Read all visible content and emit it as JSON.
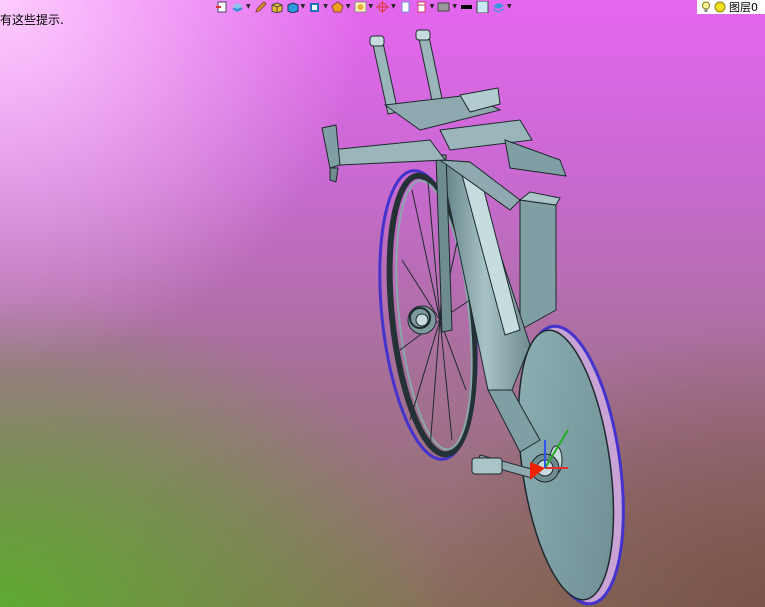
{
  "hint_text": "有这些提示.",
  "toolbar": {
    "tools": [
      {
        "name": "layer-states-icon",
        "color": "#d33"
      },
      {
        "name": "layer-manager-icon",
        "color": "#3a8fd6"
      },
      {
        "name": "pencil-icon",
        "color": "#e0a020"
      },
      {
        "name": "box-icon",
        "color": "#2e9be0"
      },
      {
        "name": "solid-icon",
        "color": "#2e7dd6"
      },
      {
        "name": "view-cube-icon",
        "color": "#1f6fc0"
      },
      {
        "name": "shading-icon",
        "color": "#f0a020"
      },
      {
        "name": "render-icon",
        "color": "#e0b030"
      },
      {
        "name": "ucs-icon",
        "color": "#d33"
      },
      {
        "name": "page-icon",
        "color": "#6a8fd0"
      },
      {
        "name": "page-setup-icon",
        "color": "#d04060"
      },
      {
        "name": "monitor-icon",
        "color": "#555"
      },
      {
        "name": "line-color-swatch",
        "color": "#000000"
      },
      {
        "name": "fill-color-swatch",
        "color": "#c8e8f4"
      },
      {
        "name": "layers-stack-icon",
        "color": "#2e9be0"
      }
    ],
    "layer_label": "图层0"
  },
  "colors": {
    "model_fill": "#7f9fa4",
    "model_edge": "#1f2b2e",
    "wheel_edge": "#4433cc"
  }
}
